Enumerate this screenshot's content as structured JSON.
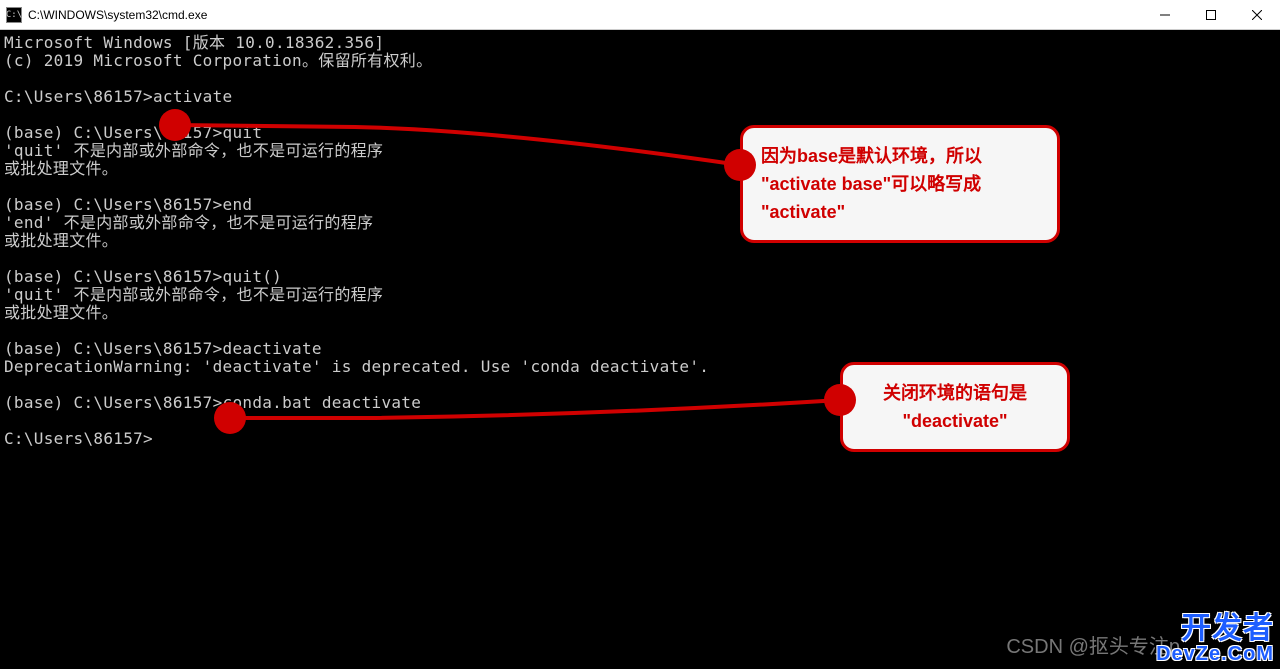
{
  "titlebar": {
    "icon_label": "C:\\",
    "title": "C:\\WINDOWS\\system32\\cmd.exe"
  },
  "terminal": {
    "lines": [
      "Microsoft Windows [版本 10.0.18362.356]",
      "(c) 2019 Microsoft Corporation。保留所有权利。",
      "",
      "C:\\Users\\86157>activate",
      "",
      "(base) C:\\Users\\86157>quit",
      "'quit' 不是内部或外部命令，也不是可运行的程序",
      "或批处理文件。",
      "",
      "(base) C:\\Users\\86157>end",
      "'end' 不是内部或外部命令，也不是可运行的程序",
      "或批处理文件。",
      "",
      "(base) C:\\Users\\86157>quit()",
      "'quit' 不是内部或外部命令，也不是可运行的程序",
      "或批处理文件。",
      "",
      "(base) C:\\Users\\86157>deactivate",
      "DeprecationWarning: 'deactivate' is deprecated. Use 'conda deactivate'.",
      "",
      "(base) C:\\Users\\86157>conda.bat deactivate",
      "",
      "C:\\Users\\86157>"
    ]
  },
  "callouts": {
    "c1_l1": "因为base是默认环境，所以",
    "c1_l2": "\"activate base\"可以略写成",
    "c1_l3": "\"activate\"",
    "c2_l1": "关闭环境的语句是",
    "c2_l2": "\"deactivate\""
  },
  "watermark": {
    "csdn": "CSDN @抠头专注p",
    "dev_l1": "开发者",
    "dev_l2": "DevZe.CoM"
  }
}
